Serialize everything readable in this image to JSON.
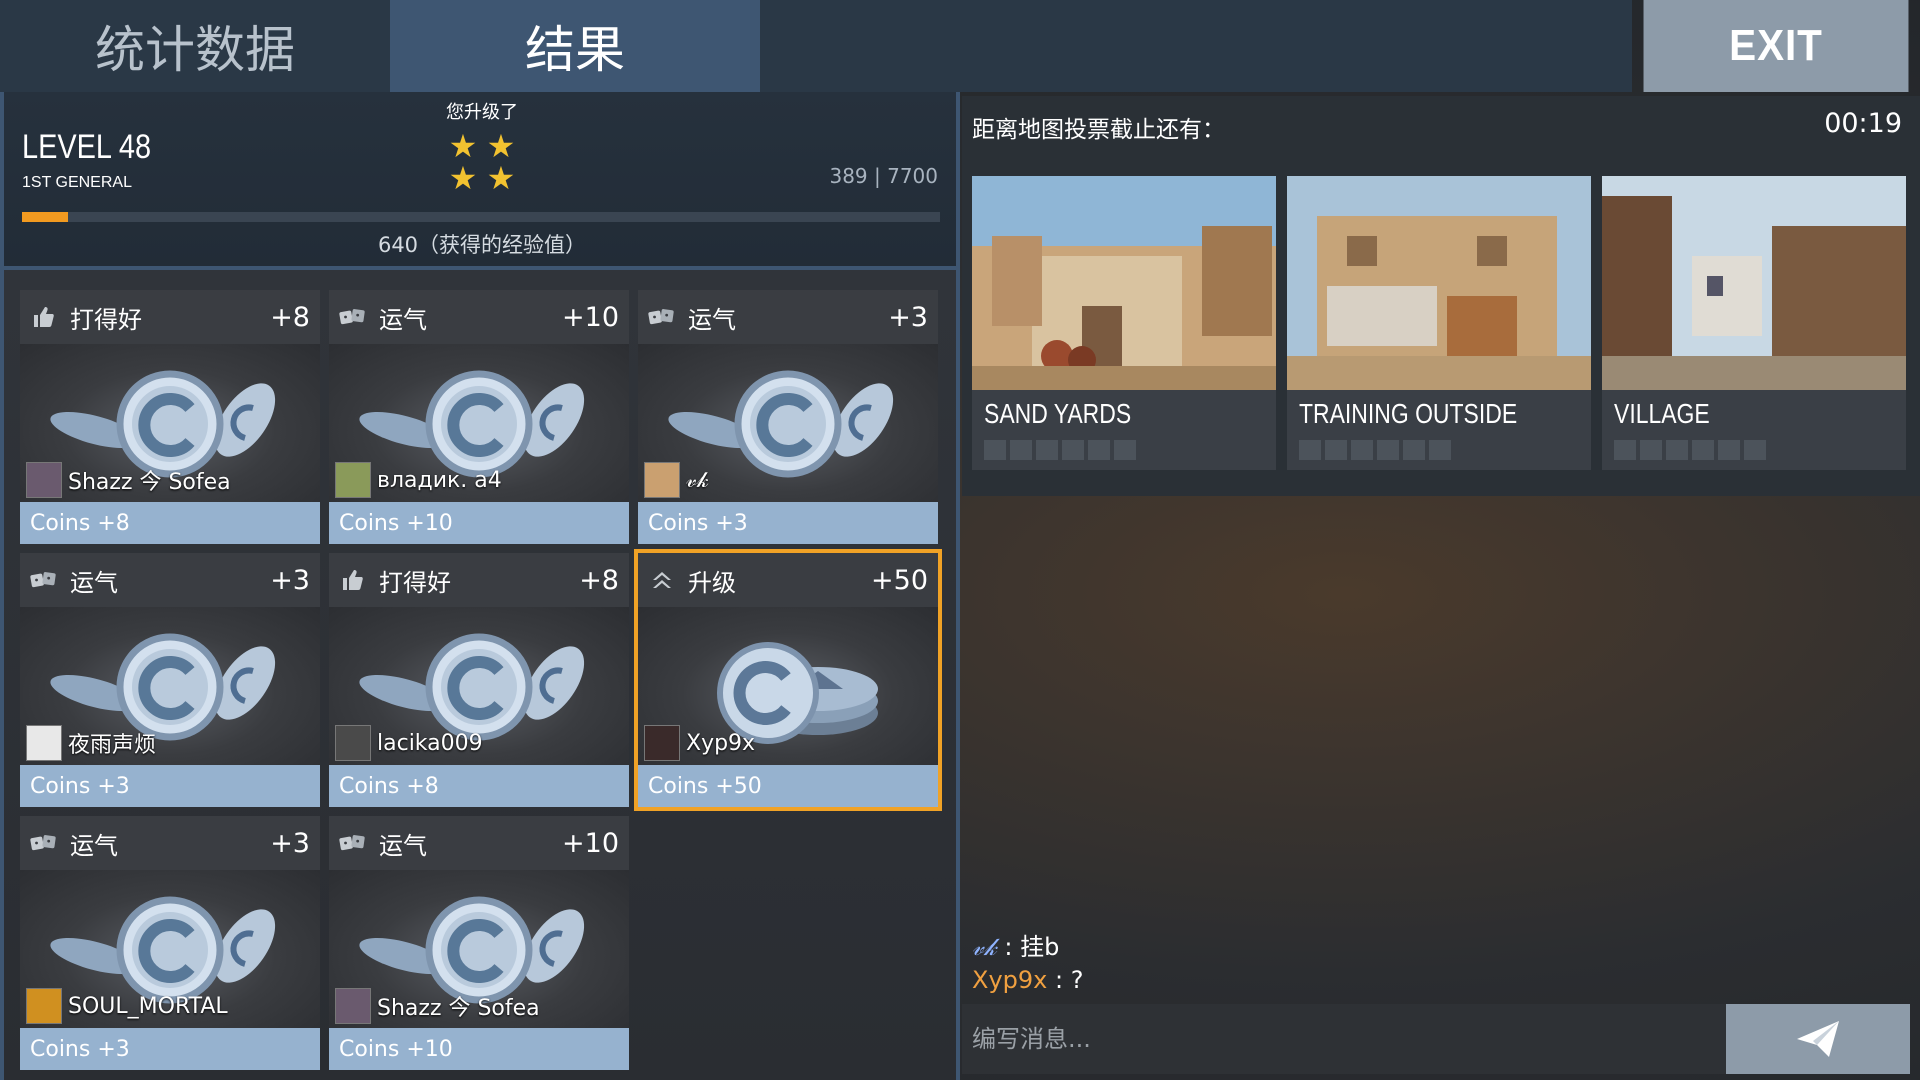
{
  "tabs": {
    "stats": "统计数据",
    "results": "结果",
    "exit": "EXIT"
  },
  "level": {
    "level_label": "LEVEL 48",
    "rank": "1ST GENERAL",
    "levelup_text": "您升级了",
    "stars": 4,
    "xp_current": "389 | 7700",
    "xp_fraction": 0.05,
    "xp_gained": "640（获得的经验值）"
  },
  "rewards": [
    {
      "icon": "thumbs-up-icon",
      "title": "打得好",
      "bonus": "+8",
      "user": "Shazz 今 Sofea",
      "coins": "Coins +8",
      "avatar_color": "#6a5a6e"
    },
    {
      "icon": "dice-icon",
      "title": "运气",
      "bonus": "+10",
      "user": "владик.   a4",
      "coins": "Coins +10",
      "avatar_color": "#8a9a5a"
    },
    {
      "icon": "dice-icon",
      "title": "运气",
      "bonus": "+3",
      "user": "𝓋𝓀",
      "coins": "Coins +3",
      "avatar_color": "#caa070"
    },
    {
      "icon": "dice-icon",
      "title": "运气",
      "bonus": "+3",
      "user": "夜雨声烦",
      "coins": "Coins +3",
      "avatar_color": "#e8e8e8"
    },
    {
      "icon": "thumbs-up-icon",
      "title": "打得好",
      "bonus": "+8",
      "user": "lacika009",
      "coins": "Coins +8",
      "avatar_color": "#4a4a4a"
    },
    {
      "icon": "rank-up-icon",
      "title": "升级",
      "bonus": "+50",
      "user": "Xyp9x",
      "coins": "Coins +50",
      "avatar_color": "#3a2a2a",
      "highlight": true
    },
    {
      "icon": "dice-icon",
      "title": "运气",
      "bonus": "+3",
      "user": "SOUL_MORTAL",
      "coins": "Coins +3",
      "avatar_color": "#d09020"
    },
    {
      "icon": "dice-icon",
      "title": "运气",
      "bonus": "+10",
      "user": "Shazz 今 Sofea",
      "coins": "Coins +10",
      "avatar_color": "#6a5a6e"
    }
  ],
  "map_vote": {
    "label": "距离地图投票截止还有：",
    "timer": "00:19",
    "maps": [
      {
        "name": "SAND YARDS",
        "votes": 0,
        "slots": 6
      },
      {
        "name": "TRAINING OUTSIDE",
        "votes": 0,
        "slots": 6
      },
      {
        "name": "VILLAGE",
        "votes": 0,
        "slots": 6
      }
    ]
  },
  "chat": {
    "messages": [
      {
        "name": "𝓋𝓀",
        "sep": " : ",
        "text": "挂b",
        "color": "blue"
      },
      {
        "name": "Xyp9x",
        "sep": " : ",
        "text": "?",
        "color": "orange"
      }
    ],
    "placeholder": "编写消息..."
  },
  "colors": {
    "accent_orange": "#f0a226",
    "coins_bar": "#96b2cf",
    "tab_active": "#3e5672",
    "exit_bg": "#8d9ba9"
  }
}
